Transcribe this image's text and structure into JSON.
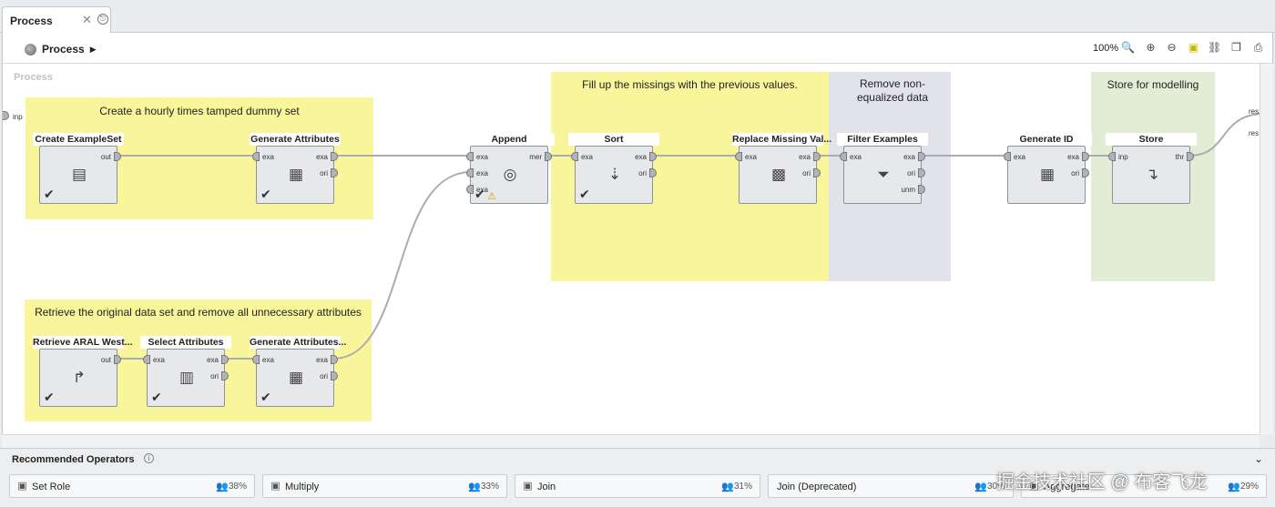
{
  "tab": {
    "label": "Process",
    "close_glyph": "✕",
    "restore_glyph": "⎋"
  },
  "toolbar": {
    "breadcrumb": "Process",
    "zoom": "100%"
  },
  "canvas": {
    "label": "Process"
  },
  "ports": {
    "left_input": "inp",
    "right_outputs": [
      "res",
      "res"
    ]
  },
  "notes": [
    "Create a hourly times tamped dummy set",
    "Retrieve the original data set and remove all unnecessary attributes",
    "Fill up the missings with the previous values.",
    "Remove non-equalized data",
    "Store for modelling"
  ],
  "operators": [
    {
      "title": "Create ExampleSet",
      "in": [],
      "out": [
        "out"
      ],
      "icon": "table-gear-icon",
      "glyph": "▤",
      "check": true
    },
    {
      "title": "Generate Attributes",
      "in": [
        "exa"
      ],
      "out": [
        "exa",
        "ori"
      ],
      "icon": "table-plus-icon",
      "glyph": "▦",
      "check": true
    },
    {
      "title": "Retrieve ARAL West...",
      "in": [],
      "out": [
        "out"
      ],
      "icon": "retrieve-arrow-icon",
      "glyph": "↱",
      "check": true
    },
    {
      "title": "Select Attributes",
      "in": [
        "exa"
      ],
      "out": [
        "exa",
        "ori"
      ],
      "icon": "table-select-icon",
      "glyph": "▥",
      "check": true
    },
    {
      "title": "Generate Attributes...",
      "in": [
        "exa"
      ],
      "out": [
        "exa",
        "ori"
      ],
      "icon": "table-plus-icon",
      "glyph": "▦",
      "check": true
    },
    {
      "title": "Append",
      "in": [
        "exa",
        "exa",
        "exa"
      ],
      "out": [
        "mer"
      ],
      "icon": "append-circles-icon",
      "glyph": "◎",
      "check": true,
      "warn": true
    },
    {
      "title": "Sort",
      "in": [
        "exa"
      ],
      "out": [
        "exa",
        "ori"
      ],
      "icon": "sort-az-icon",
      "glyph": "⇣",
      "check": true
    },
    {
      "title": "Replace Missing Val...",
      "in": [
        "exa"
      ],
      "out": [
        "exa",
        "ori"
      ],
      "icon": "replace-missing-icon",
      "glyph": "▩",
      "check": false
    },
    {
      "title": "Filter Examples",
      "in": [
        "exa"
      ],
      "out": [
        "exa",
        "ori",
        "unm"
      ],
      "icon": "funnel-icon",
      "glyph": "⏷",
      "check": false
    },
    {
      "title": "Generate ID",
      "in": [
        "exa"
      ],
      "out": [
        "exa",
        "ori"
      ],
      "icon": "table-plus-icon",
      "glyph": "▦",
      "check": false
    },
    {
      "title": "Store",
      "in": [
        "inp"
      ],
      "out": [
        "thr"
      ],
      "icon": "store-arrow-icon",
      "glyph": "↴",
      "check": false
    }
  ],
  "recommended": {
    "title": "Recommended Operators",
    "items": [
      {
        "name": "Set Role",
        "pct": "38%",
        "icon": "set-role-icon"
      },
      {
        "name": "Multiply",
        "pct": "33%",
        "icon": "multiply-icon"
      },
      {
        "name": "Join",
        "pct": "31%",
        "icon": "join-icon"
      },
      {
        "name": "Join (Deprecated)",
        "pct": "30%",
        "icon": ""
      },
      {
        "name": "Aggregate",
        "pct": "29%",
        "icon": "aggregate-icon"
      }
    ]
  },
  "watermark": "掘金技术社区 @ 布客飞龙",
  "colors": {
    "note_yellow": "#f8f59b",
    "note_gray": "#e2e3ea",
    "note_green": "#e3edd5",
    "wire": "#a9acb0"
  }
}
